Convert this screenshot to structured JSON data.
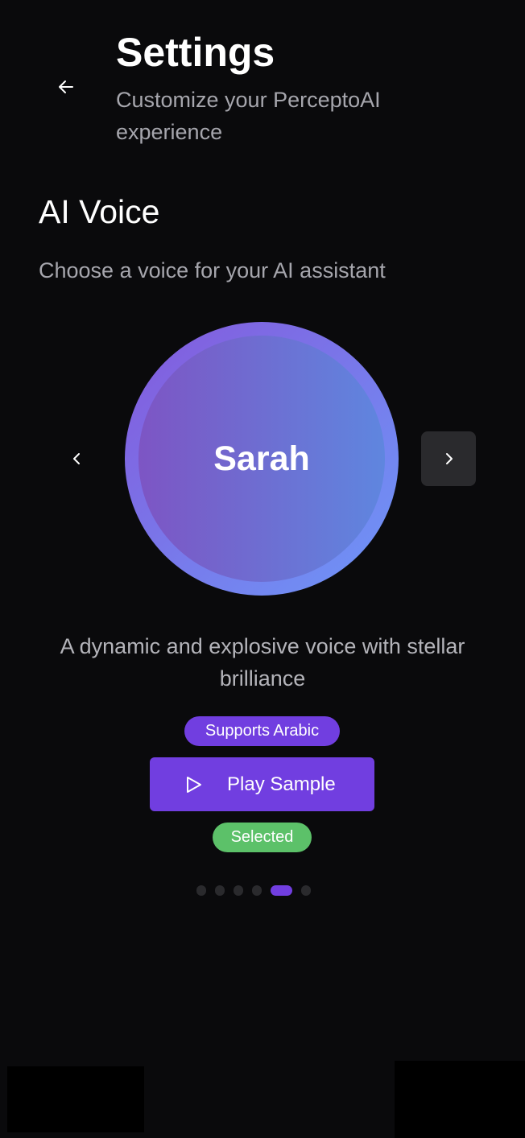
{
  "header": {
    "title": "Settings",
    "subtitle": "Customize your PerceptoAI experience"
  },
  "section": {
    "title": "AI Voice",
    "description": "Choose a voice for your AI assistant"
  },
  "voice": {
    "name": "Sarah",
    "description": "A dynamic and explosive voice with stellar brilliance",
    "badge": "Supports Arabic",
    "play_label": "Play Sample",
    "status": "Selected"
  },
  "pagination": {
    "total": 6,
    "active_index": 4
  },
  "colors": {
    "accent": "#713ee0",
    "success": "#5cc169",
    "background": "#0a0a0c"
  }
}
